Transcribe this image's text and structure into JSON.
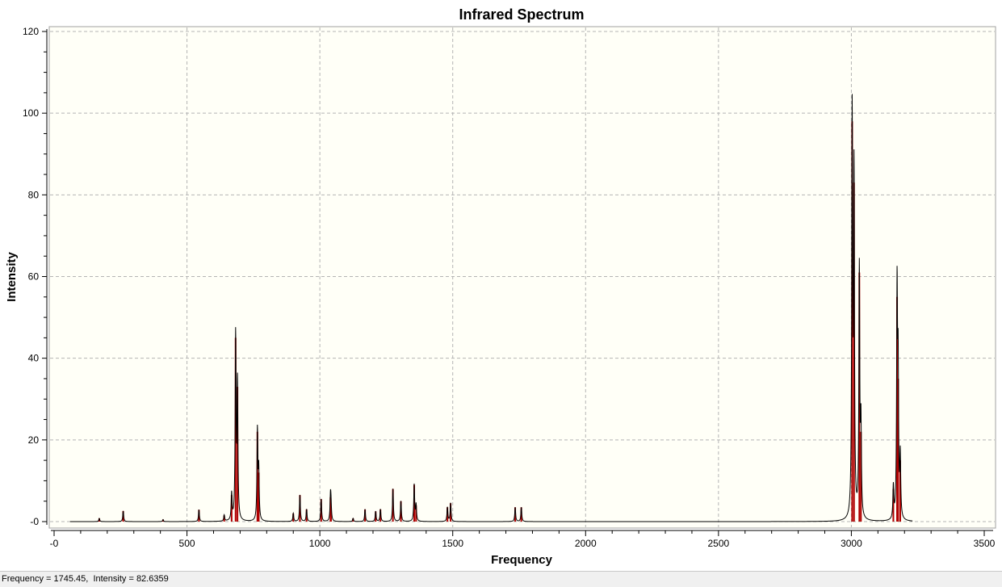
{
  "status_bar": {
    "text": "Frequency = 1745.45,  Intensity = 82.6359"
  },
  "colors": {
    "plot_background": "#fffff7",
    "spectrum_line": "#000000",
    "stick": "#b00000",
    "grid": "#b4b4b4"
  },
  "chart_data": {
    "type": "line",
    "title": "Infrared Spectrum",
    "xlabel": "Frequency",
    "ylabel": "Intensity",
    "xlim": [
      -25,
      3500
    ],
    "ylim": [
      -0.5,
      120
    ],
    "x_ticks": [
      0,
      500,
      1000,
      1500,
      2000,
      2500,
      3000,
      3500
    ],
    "x_tick_labels": [
      "-0",
      "500",
      "1000",
      "1500",
      "2000",
      "2500",
      "3000",
      "3500"
    ],
    "y_ticks": [
      0,
      20,
      40,
      60,
      80,
      100,
      120
    ],
    "y_tick_labels": [
      "-0",
      "20",
      "40",
      "60",
      "80",
      "100",
      "120"
    ],
    "grid": true,
    "line_width_cm1": 4,
    "spectrum_range": [
      60,
      3230
    ],
    "series": [
      {
        "name": "",
        "style": "broadened-spectrum",
        "sticks": [
          {
            "x": 170,
            "y": 0.8
          },
          {
            "x": 260,
            "y": 2.6
          },
          {
            "x": 410,
            "y": 0.5
          },
          {
            "x": 545,
            "y": 2.9
          },
          {
            "x": 640,
            "y": 1.5
          },
          {
            "x": 668,
            "y": 6.5
          },
          {
            "x": 683,
            "y": 45
          },
          {
            "x": 690,
            "y": 33
          },
          {
            "x": 765,
            "y": 22
          },
          {
            "x": 770,
            "y": 12
          },
          {
            "x": 900,
            "y": 2.0
          },
          {
            "x": 925,
            "y": 6.5
          },
          {
            "x": 950,
            "y": 3.0
          },
          {
            "x": 1005,
            "y": 5.5
          },
          {
            "x": 1040,
            "y": 6.0
          },
          {
            "x": 1042,
            "y": 3.5
          },
          {
            "x": 1125,
            "y": 0.8
          },
          {
            "x": 1170,
            "y": 3.0
          },
          {
            "x": 1210,
            "y": 2.5
          },
          {
            "x": 1228,
            "y": 3.0
          },
          {
            "x": 1275,
            "y": 8.0
          },
          {
            "x": 1305,
            "y": 5.0
          },
          {
            "x": 1355,
            "y": 9.0
          },
          {
            "x": 1362,
            "y": 4.0
          },
          {
            "x": 1480,
            "y": 3.5
          },
          {
            "x": 1492,
            "y": 4.5
          },
          {
            "x": 1735,
            "y": 3.5
          },
          {
            "x": 1758,
            "y": 3.5
          },
          {
            "x": 3003,
            "y": 98
          },
          {
            "x": 3010,
            "y": 83
          },
          {
            "x": 3030,
            "y": 61
          },
          {
            "x": 3036,
            "y": 22
          },
          {
            "x": 3158,
            "y": 8
          },
          {
            "x": 3172,
            "y": 55
          },
          {
            "x": 3176,
            "y": 35
          },
          {
            "x": 3184,
            "y": 15
          }
        ]
      }
    ]
  }
}
